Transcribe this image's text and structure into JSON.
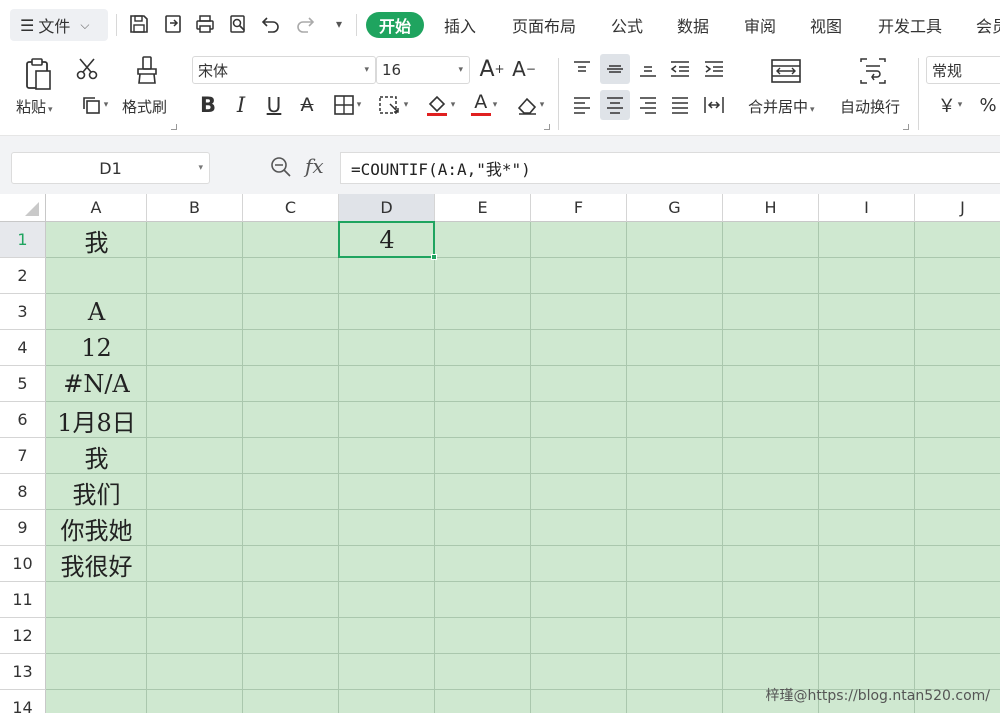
{
  "menubar": {
    "file_label": "文件",
    "tabs": [
      {
        "label": "开始",
        "active": true
      },
      {
        "label": "插入"
      },
      {
        "label": "页面布局"
      },
      {
        "label": "公式"
      },
      {
        "label": "数据"
      },
      {
        "label": "审阅"
      },
      {
        "label": "视图"
      },
      {
        "label": "开发工具"
      },
      {
        "label": "会员"
      }
    ],
    "accent_color": "#1fa45f"
  },
  "ribbon": {
    "paste_label": "粘贴",
    "format_painter_label": "格式刷",
    "font_name": "宋体",
    "font_size": "16",
    "merge_label": "合并居中",
    "wrap_label": "自动换行",
    "number_format": "常规",
    "currency_symbol": "￥",
    "percent_symbol": "%",
    "bold": "B",
    "italic": "I",
    "underline": "U",
    "strike": "A",
    "font_color_letter": "A",
    "grow_font": "A",
    "shrink_font": "A"
  },
  "formula_bar": {
    "name_box": "D1",
    "fx": "fx",
    "formula": "=COUNTIF(A:A,\"我*\")"
  },
  "sheet": {
    "columns": [
      "A",
      "B",
      "C",
      "D",
      "E",
      "F",
      "G",
      "H",
      "I",
      "J"
    ],
    "rows": [
      "1",
      "2",
      "3",
      "4",
      "5",
      "6",
      "7",
      "8",
      "9",
      "10",
      "11",
      "12",
      "13",
      "14"
    ],
    "selected_cell": "D1",
    "cells": {
      "A1": "我",
      "A3": "A",
      "A4": "12",
      "A5": "#N/A",
      "A6": "1月8日",
      "A7": "我",
      "A8": "我们",
      "A9": "你我她",
      "A10": "我很好",
      "D1": "4"
    },
    "background_color": "#cfe8d0"
  },
  "watermark": "梓瑾@https://blog.ntan520.com/"
}
